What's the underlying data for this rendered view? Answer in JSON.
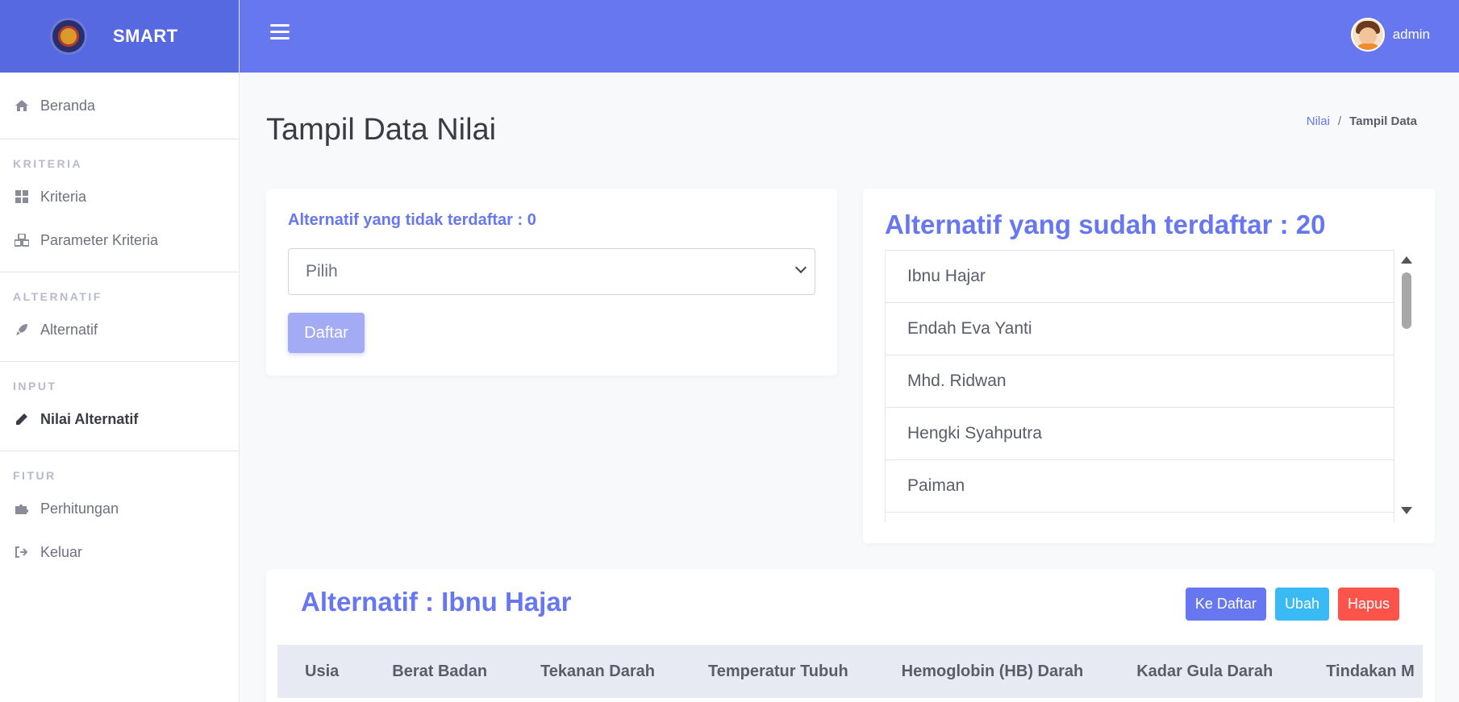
{
  "brand": {
    "name": "SMART",
    "logo_icon": "emblem-logo-icon"
  },
  "sidebar": {
    "items": [
      {
        "label": "Beranda",
        "icon": "home-icon"
      }
    ],
    "sections": [
      {
        "heading": "KRITERIA",
        "items": [
          {
            "label": "Kriteria",
            "icon": "grid-icon"
          },
          {
            "label": "Parameter Kriteria",
            "icon": "cubes-icon"
          }
        ]
      },
      {
        "heading": "ALTERNATIF",
        "items": [
          {
            "label": "Alternatif",
            "icon": "rocket-icon"
          }
        ]
      },
      {
        "heading": "INPUT",
        "items": [
          {
            "label": "Nilai Alternatif",
            "icon": "pencil-icon",
            "active": true
          }
        ]
      },
      {
        "heading": "FITUR",
        "items": [
          {
            "label": "Perhitungan",
            "icon": "puzzle-icon"
          },
          {
            "label": "Keluar",
            "icon": "sign-out-icon"
          }
        ]
      }
    ]
  },
  "topbar": {
    "user_name": "admin"
  },
  "page": {
    "title": "Tampil Data Nilai",
    "breadcrumb": {
      "link": "Nilai",
      "separator": "/",
      "current": "Tampil Data"
    }
  },
  "unregistered": {
    "header": "Alternatif yang tidak terdaftar : 0",
    "select_value": "Pilih",
    "button": "Daftar"
  },
  "registered": {
    "header": "Alternatif yang sudah terdaftar : 20",
    "items": [
      "Ibnu Hajar",
      "Endah Eva Yanti",
      "Mhd. Ridwan",
      "Hengki Syahputra",
      "Paiman"
    ]
  },
  "detail": {
    "header": "Alternatif : Ibnu Hajar",
    "buttons": {
      "to_list": "Ke Daftar",
      "edit": "Ubah",
      "delete": "Hapus"
    },
    "columns": [
      "Usia",
      "Berat Badan",
      "Tekanan Darah",
      "Temperatur Tubuh",
      "Hemoglobin (HB) Darah",
      "Kadar Gula Darah",
      "Tindakan M"
    ]
  },
  "colors": {
    "accent": "#6777ef",
    "brand_bg": "#5669e0",
    "info": "#3abaf4",
    "danger": "#fc544b"
  }
}
